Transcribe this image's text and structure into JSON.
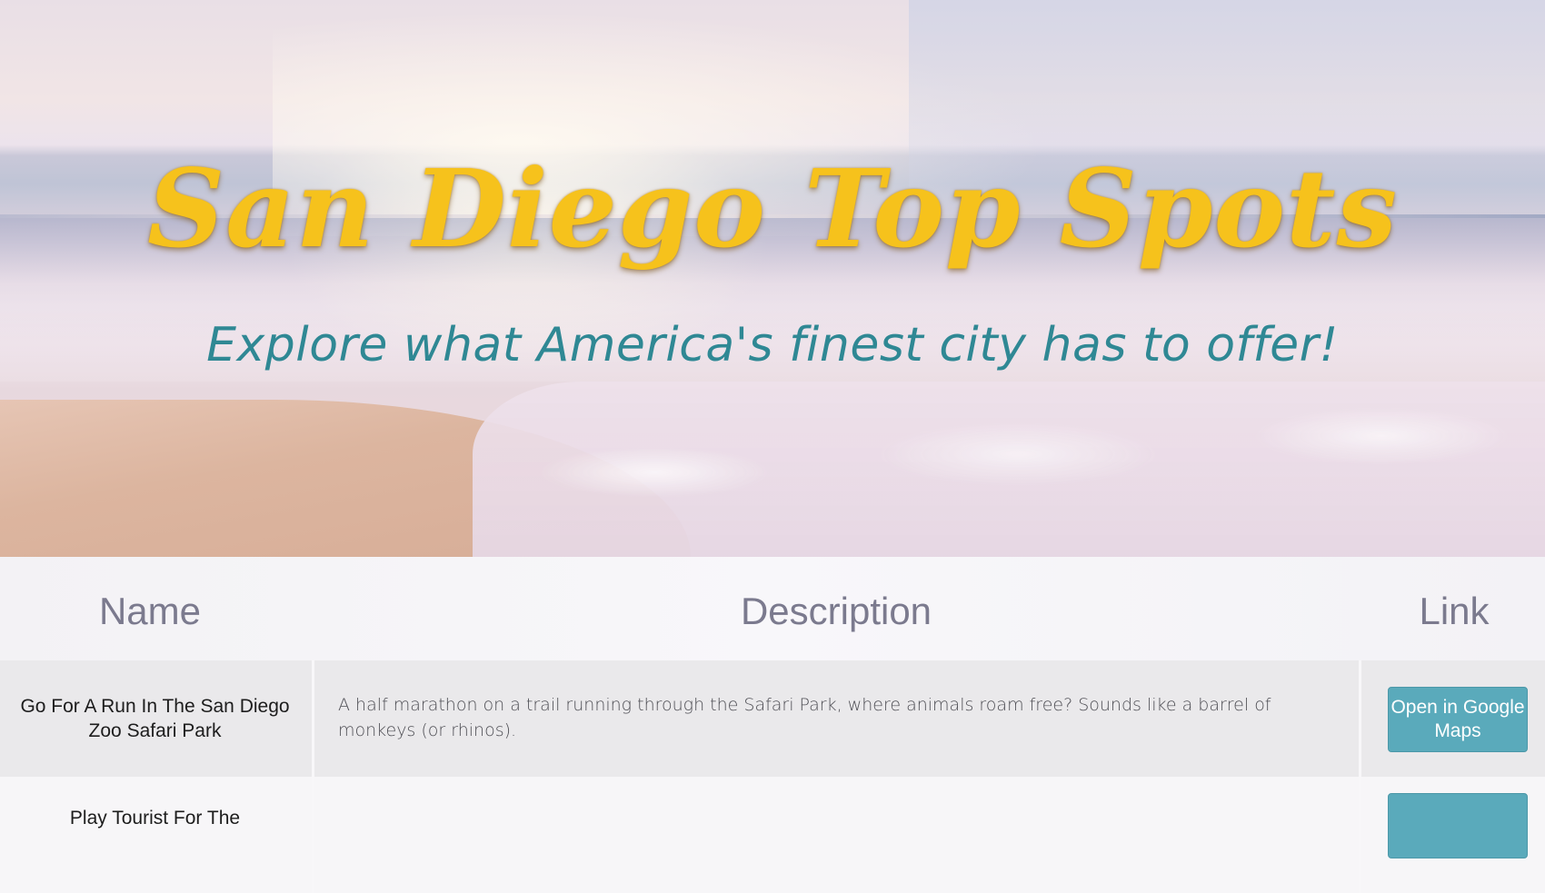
{
  "hero": {
    "title": "San Diego Top Spots",
    "subtitle": "Explore what America's finest city has to offer!"
  },
  "table": {
    "headers": {
      "name": "Name",
      "description": "Description",
      "link": "Link"
    },
    "rows": [
      {
        "name": "Go For A Run In The San Diego Zoo Safari Park",
        "description": "A half marathon on a trail running through the Safari Park, where animals roam free? Sounds like a barrel of monkeys (or rhinos).",
        "link_label": "Open in Google Maps"
      },
      {
        "name": "Play Tourist For The",
        "description": "",
        "link_label": ""
      }
    ]
  },
  "colors": {
    "title": "#f6c21c",
    "subtitle": "#2f8894",
    "button": "#5aaabb",
    "header_text": "#7b7a8e"
  }
}
